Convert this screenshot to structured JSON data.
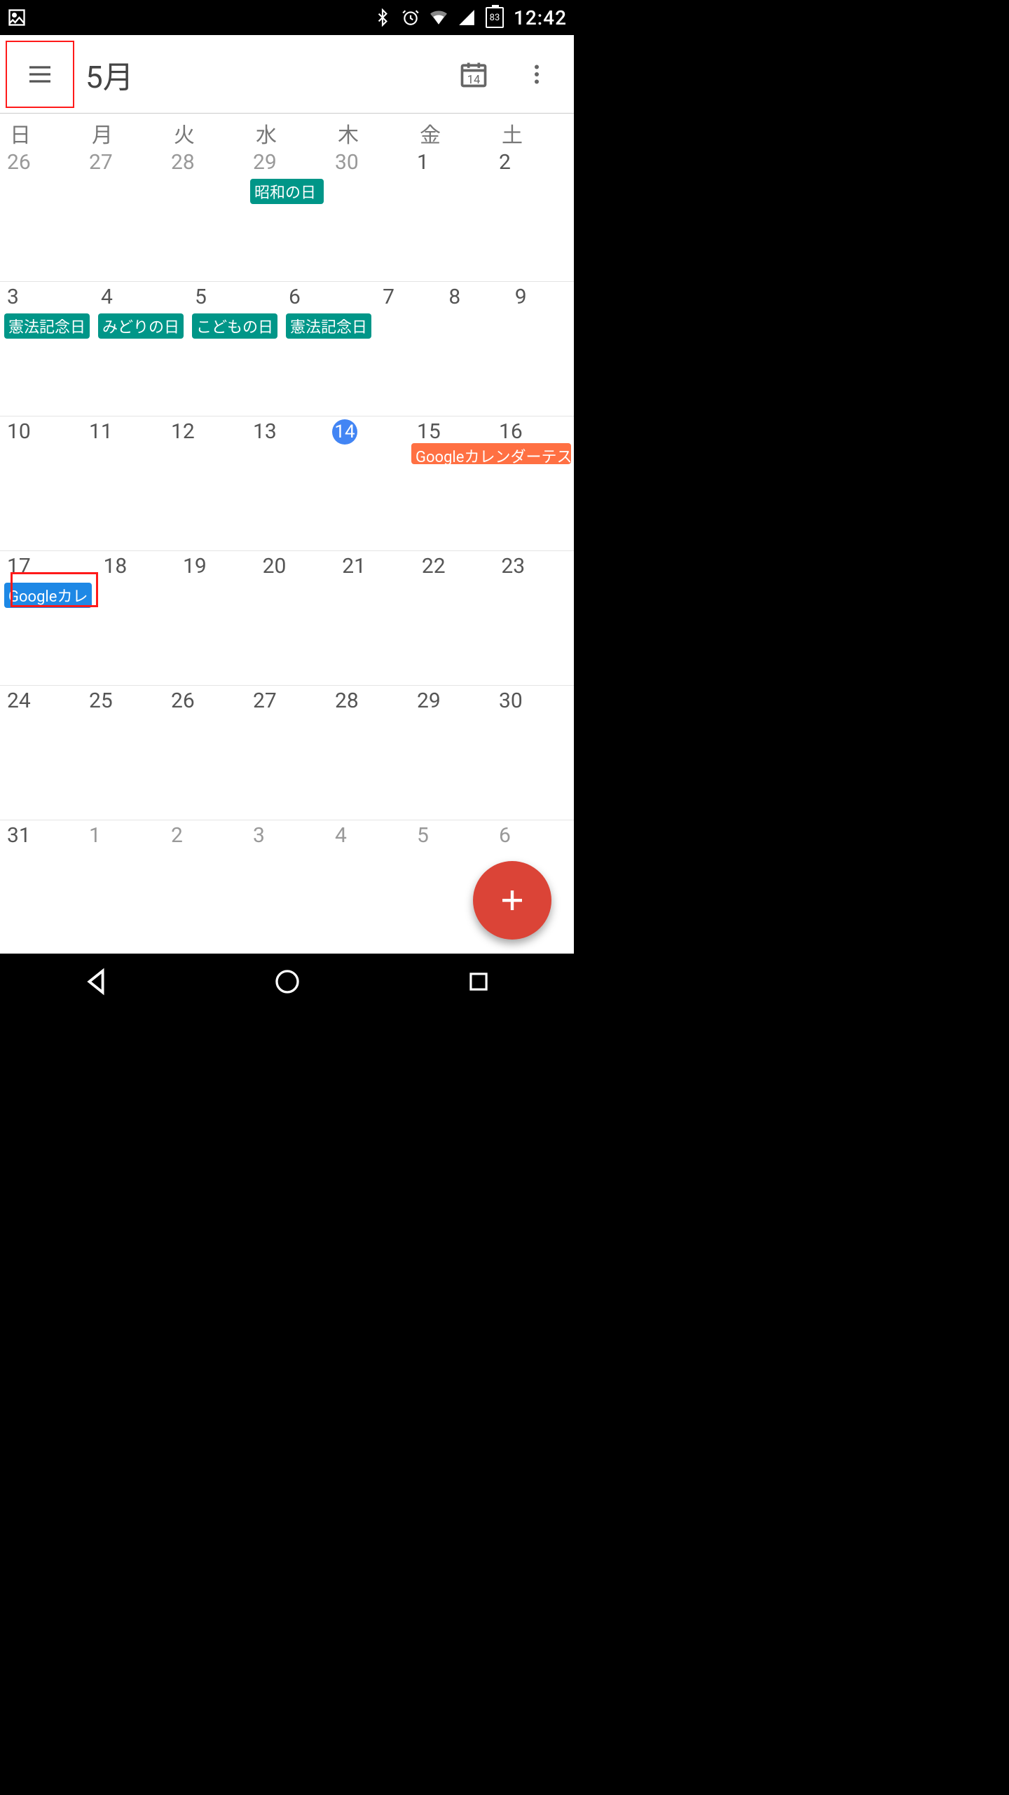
{
  "status": {
    "time": "12:42",
    "battery": "83"
  },
  "appbar": {
    "title": "5月",
    "today_badge": "14"
  },
  "dow": [
    "日",
    "月",
    "火",
    "水",
    "木",
    "金",
    "土"
  ],
  "weeks": [
    {
      "days": [
        {
          "n": "26",
          "dim": true
        },
        {
          "n": "27",
          "dim": true
        },
        {
          "n": "28",
          "dim": true
        },
        {
          "n": "29",
          "dim": true,
          "chips": [
            {
              "t": "昭和の日",
              "c": "teal"
            }
          ]
        },
        {
          "n": "30",
          "dim": true
        },
        {
          "n": "1"
        },
        {
          "n": "2"
        }
      ]
    },
    {
      "days": [
        {
          "n": "3",
          "chips": [
            {
              "t": "憲法記念日",
              "c": "teal"
            }
          ]
        },
        {
          "n": "4",
          "chips": [
            {
              "t": "みどりの日",
              "c": "teal"
            }
          ]
        },
        {
          "n": "5",
          "chips": [
            {
              "t": "こどもの日",
              "c": "teal"
            }
          ]
        },
        {
          "n": "6",
          "chips": [
            {
              "t": "憲法記念日",
              "c": "teal"
            }
          ]
        },
        {
          "n": "7"
        },
        {
          "n": "8"
        },
        {
          "n": "9"
        }
      ]
    },
    {
      "days": [
        {
          "n": "10"
        },
        {
          "n": "11"
        },
        {
          "n": "12"
        },
        {
          "n": "13"
        },
        {
          "n": "14",
          "today": true
        },
        {
          "n": "15"
        },
        {
          "n": "16"
        }
      ],
      "spans": [
        {
          "t": "Googleカレンダーテス",
          "c": "orange",
          "startCol": 5,
          "endCol": 6
        }
      ]
    },
    {
      "days": [
        {
          "n": "17",
          "chips": [
            {
              "t": "Googleカレ",
              "c": "blue"
            }
          ]
        },
        {
          "n": "18"
        },
        {
          "n": "19"
        },
        {
          "n": "20"
        },
        {
          "n": "21"
        },
        {
          "n": "22"
        },
        {
          "n": "23"
        }
      ]
    },
    {
      "days": [
        {
          "n": "24"
        },
        {
          "n": "25"
        },
        {
          "n": "26"
        },
        {
          "n": "27"
        },
        {
          "n": "28"
        },
        {
          "n": "29"
        },
        {
          "n": "30"
        }
      ]
    },
    {
      "days": [
        {
          "n": "31"
        },
        {
          "n": "1",
          "dim": true
        },
        {
          "n": "2",
          "dim": true
        },
        {
          "n": "3",
          "dim": true
        },
        {
          "n": "4",
          "dim": true
        },
        {
          "n": "5",
          "dim": true
        },
        {
          "n": "6",
          "dim": true
        }
      ]
    }
  ],
  "colors": {
    "teal": "#009688",
    "orange": "#ff7043",
    "blue": "#1e88e5",
    "fab": "#db4437",
    "today": "#4285f4"
  }
}
